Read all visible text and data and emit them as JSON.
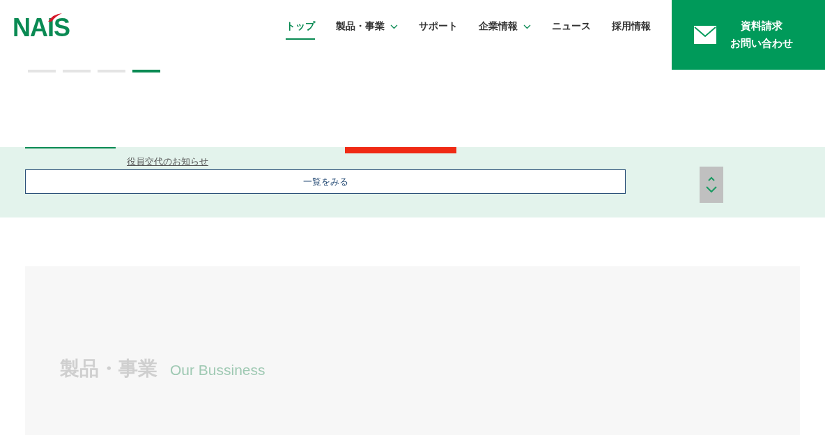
{
  "header": {
    "logo": "NAIS",
    "nav": [
      {
        "label": "トップ",
        "selected": true,
        "has_menu": false
      },
      {
        "label": "製品・事業",
        "selected": false,
        "has_menu": true
      },
      {
        "label": "サポート",
        "selected": false,
        "has_menu": false
      },
      {
        "label": "企業情報",
        "selected": false,
        "has_menu": true
      },
      {
        "label": "ニュース",
        "selected": false,
        "has_menu": false
      },
      {
        "label": "採用情報",
        "selected": false,
        "has_menu": false
      }
    ],
    "contact": {
      "line_1": "資料請求",
      "line_2": "お問い合わせ"
    }
  },
  "slider_dots": [
    {
      "selected": false
    },
    {
      "selected": false
    },
    {
      "selected": false
    },
    {
      "selected": true
    }
  ],
  "news": {
    "link": "役員交代のお知らせ",
    "more_button": "一覧をみる"
  },
  "business": {
    "title": "製品・事業",
    "subtitle": "Our Bussiness"
  }
}
